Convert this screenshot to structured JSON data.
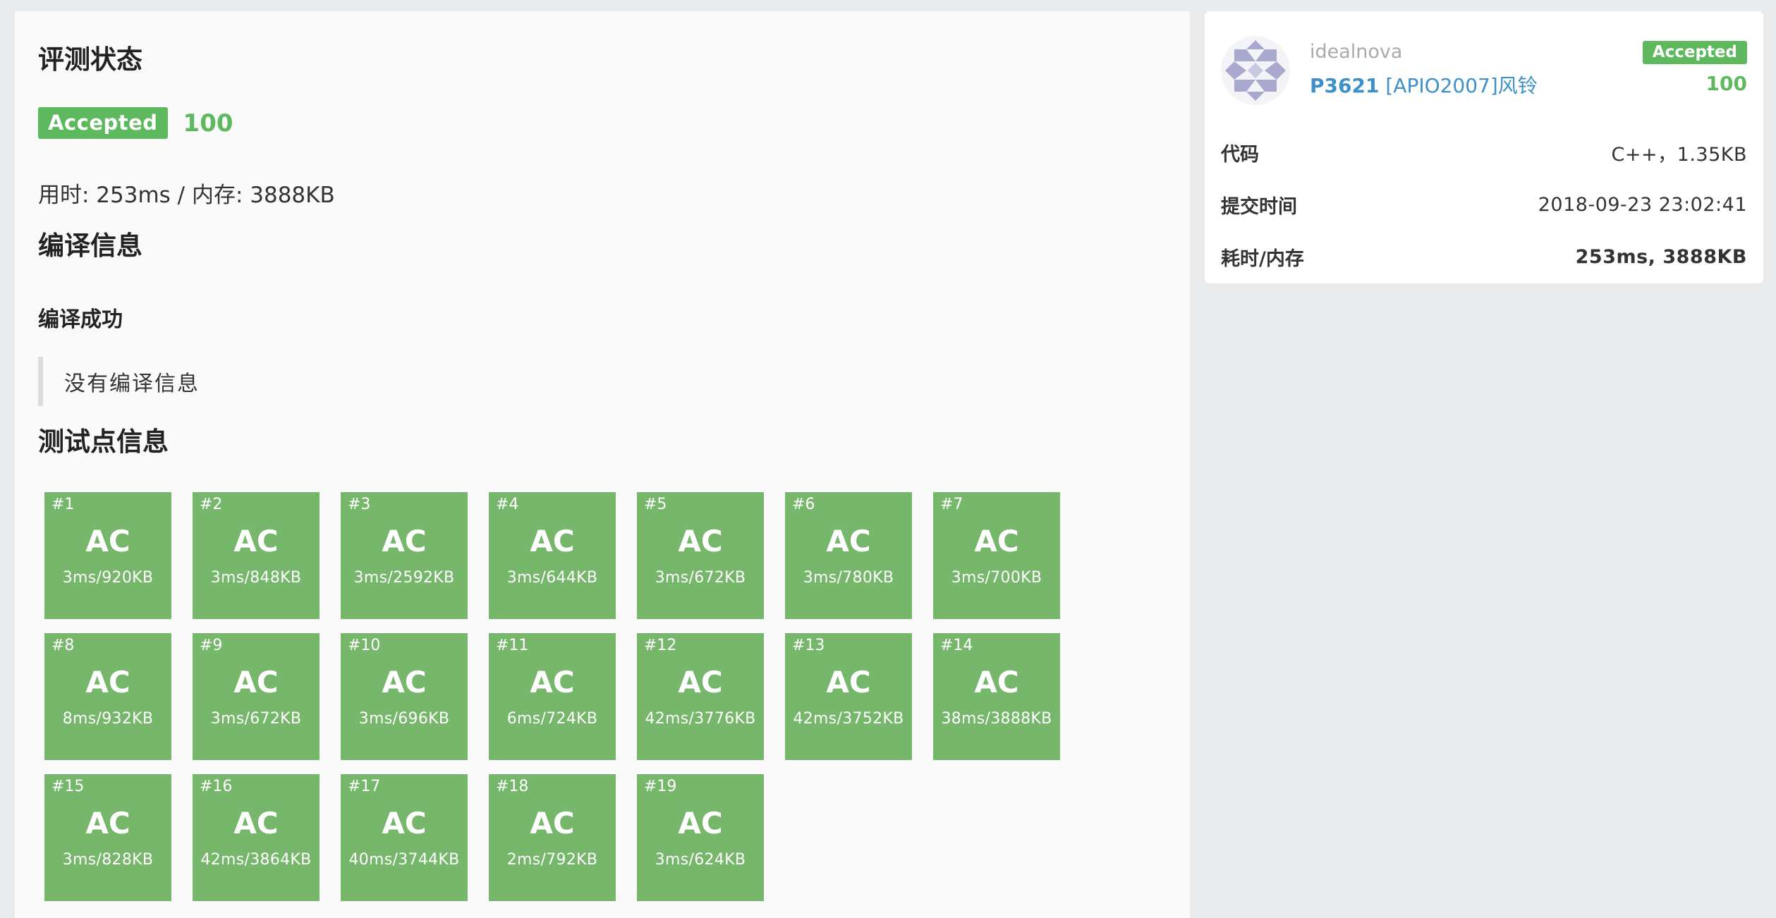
{
  "colors": {
    "accepted": "#5eb95e",
    "case_ac": "#77b76c",
    "link": "#3e90c6",
    "page_bg": "#e9eaec",
    "panel_bg": "#fafafa"
  },
  "main": {
    "status_title": "评测状态",
    "status_badge": "Accepted",
    "score": "100",
    "usage": "用时: 253ms / 内存: 3888KB",
    "compile_title": "编译信息",
    "compile_result": "编译成功",
    "compile_message": "没有编译信息",
    "testcases_title": "测试点信息",
    "testcases": [
      {
        "id": "#1",
        "status": "AC",
        "info": "3ms/920KB"
      },
      {
        "id": "#2",
        "status": "AC",
        "info": "3ms/848KB"
      },
      {
        "id": "#3",
        "status": "AC",
        "info": "3ms/2592KB"
      },
      {
        "id": "#4",
        "status": "AC",
        "info": "3ms/644KB"
      },
      {
        "id": "#5",
        "status": "AC",
        "info": "3ms/672KB"
      },
      {
        "id": "#6",
        "status": "AC",
        "info": "3ms/780KB"
      },
      {
        "id": "#7",
        "status": "AC",
        "info": "3ms/700KB"
      },
      {
        "id": "#8",
        "status": "AC",
        "info": "8ms/932KB"
      },
      {
        "id": "#9",
        "status": "AC",
        "info": "3ms/672KB"
      },
      {
        "id": "#10",
        "status": "AC",
        "info": "3ms/696KB"
      },
      {
        "id": "#11",
        "status": "AC",
        "info": "6ms/724KB"
      },
      {
        "id": "#12",
        "status": "AC",
        "info": "42ms/3776KB"
      },
      {
        "id": "#13",
        "status": "AC",
        "info": "42ms/3752KB"
      },
      {
        "id": "#14",
        "status": "AC",
        "info": "38ms/3888KB"
      },
      {
        "id": "#15",
        "status": "AC",
        "info": "3ms/828KB"
      },
      {
        "id": "#16",
        "status": "AC",
        "info": "42ms/3864KB"
      },
      {
        "id": "#17",
        "status": "AC",
        "info": "40ms/3744KB"
      },
      {
        "id": "#18",
        "status": "AC",
        "info": "2ms/792KB"
      },
      {
        "id": "#19",
        "status": "AC",
        "info": "3ms/624KB"
      }
    ]
  },
  "side": {
    "avatar_icon": "identicon-avatar",
    "username": "idealnova",
    "problem_id": "P3621",
    "problem_name": "[APIO2007]风铃",
    "status_badge": "Accepted",
    "score": "100",
    "rows": [
      {
        "label": "代码",
        "value": "C++，1.35KB",
        "bold": false
      },
      {
        "label": "提交时间",
        "value": "2018-09-23 23:02:41",
        "bold": false
      },
      {
        "label": "耗时/内存",
        "value": "253ms, 3888KB",
        "bold": true
      }
    ]
  }
}
